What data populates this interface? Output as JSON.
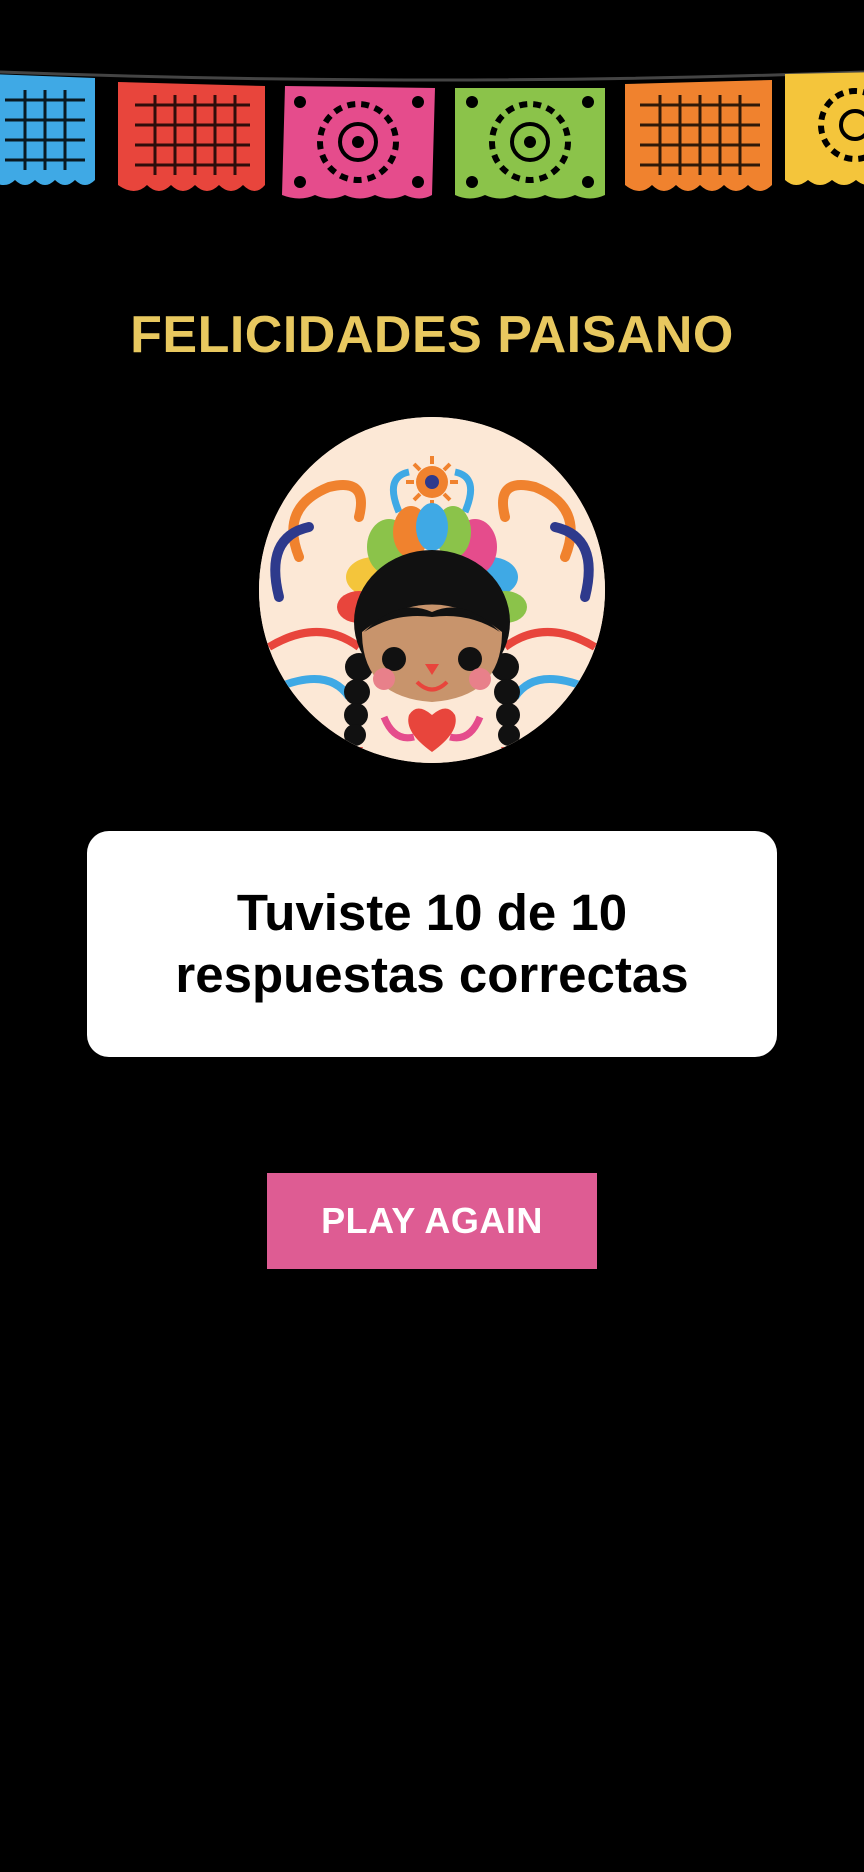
{
  "header": {
    "title": "FELICIDADES PAISANO",
    "title_color": "#E8C85F"
  },
  "banner": {
    "icon": "papel-picado-banner",
    "flag_colors": [
      "#3FA9E5",
      "#E8453C",
      "#E54C8C",
      "#8BC34A",
      "#F0822E",
      "#F4C53B"
    ]
  },
  "avatar": {
    "icon": "maria-doll-illustration"
  },
  "result": {
    "text": "Tuviste 10 de 10 respuestas correctas",
    "correct": 10,
    "total": 10
  },
  "actions": {
    "play_again_label": "PLAY AGAIN",
    "play_again_color": "#DE5C93"
  },
  "colors": {
    "background": "#000000",
    "card": "#FFFFFF"
  }
}
